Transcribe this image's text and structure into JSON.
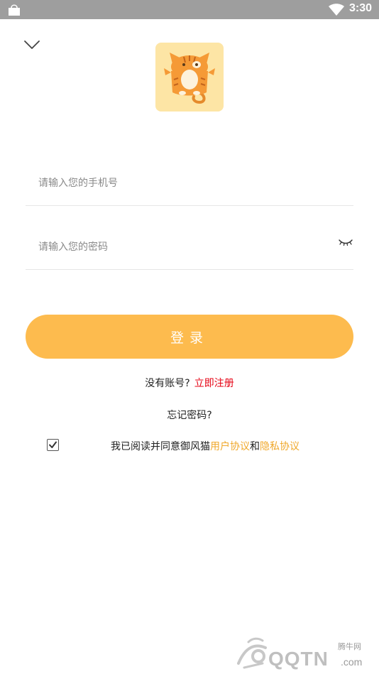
{
  "status_bar": {
    "time": "3:30",
    "icons": [
      "shopping-bag-icon",
      "wifi-icon"
    ]
  },
  "header": {
    "back_icon": "chevron-down-icon"
  },
  "logo": {
    "icon": "cat-app-logo"
  },
  "form": {
    "phone_placeholder": "请输入您的手机号",
    "phone_value": "",
    "password_placeholder": "请输入您的密码",
    "password_value": "",
    "eye_icon": "eye-closed-icon",
    "login_label": "登录"
  },
  "register": {
    "prompt": "没有账号?",
    "link": "立即注册"
  },
  "forgot": {
    "label": "忘记密码?"
  },
  "agreement": {
    "checked": true,
    "prefix": "我已阅读并同意御风猫",
    "user_agreement": "用户协议",
    "and": "和",
    "privacy_agreement": "隐私协议"
  },
  "watermark": {
    "text": "QQTN",
    "cn_text": "腾牛网",
    "suffix": ".com"
  },
  "colors": {
    "accent": "#fdbb4e",
    "link_red": "#e60012",
    "link_orange": "#f0a82b",
    "logo_bg": "#fde5a5"
  }
}
